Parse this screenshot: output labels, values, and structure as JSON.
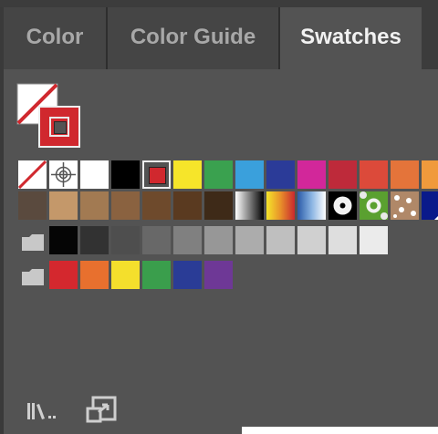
{
  "tabs": [
    {
      "label": "Color",
      "active": false
    },
    {
      "label": "Color Guide",
      "active": false
    },
    {
      "label": "Swatches",
      "active": true
    }
  ],
  "fill_stroke": {
    "fill": "none",
    "stroke": "#d0282e"
  },
  "swatch_rows": [
    {
      "group": false,
      "swatches": [
        {
          "kind": "none"
        },
        {
          "kind": "registration"
        },
        {
          "kind": "solid",
          "color": "#ffffff"
        },
        {
          "kind": "solid",
          "color": "#000000"
        },
        {
          "kind": "selected",
          "color": "#d0282e"
        },
        {
          "kind": "solid",
          "color": "#f6e52a"
        },
        {
          "kind": "solid",
          "color": "#3aa14f"
        },
        {
          "kind": "solid",
          "color": "#3aa0dc"
        },
        {
          "kind": "solid",
          "color": "#2b3b98"
        },
        {
          "kind": "solid",
          "color": "#d2279a"
        },
        {
          "kind": "solid",
          "color": "#be2a3a"
        },
        {
          "kind": "solid",
          "color": "#dc4a3a"
        },
        {
          "kind": "solid",
          "color": "#e4743a"
        },
        {
          "kind": "solid",
          "color": "#f09a3c"
        }
      ]
    },
    {
      "group": false,
      "swatches": [
        {
          "kind": "solid",
          "color": "#5a4a3e"
        },
        {
          "kind": "solid",
          "color": "#c4986a"
        },
        {
          "kind": "solid",
          "color": "#a27a52"
        },
        {
          "kind": "solid",
          "color": "#8a6240"
        },
        {
          "kind": "solid",
          "color": "#6e4a2c"
        },
        {
          "kind": "solid",
          "color": "#5a3a20"
        },
        {
          "kind": "solid",
          "color": "#3e2a18"
        },
        {
          "kind": "gradient-gray"
        },
        {
          "kind": "gradient-orange"
        },
        {
          "kind": "gradient-blue"
        },
        {
          "kind": "pattern-dots"
        },
        {
          "kind": "pattern-green"
        },
        {
          "kind": "pattern-leopard"
        },
        {
          "kind": "pattern-navy"
        }
      ]
    },
    {
      "group": true,
      "swatches": [
        {
          "kind": "solid",
          "color": "#050505"
        },
        {
          "kind": "solid",
          "color": "#323232"
        },
        {
          "kind": "solid",
          "color": "#4e4e4e"
        },
        {
          "kind": "solid",
          "color": "#686868"
        },
        {
          "kind": "solid",
          "color": "#808080"
        },
        {
          "kind": "solid",
          "color": "#979797"
        },
        {
          "kind": "solid",
          "color": "#acacac"
        },
        {
          "kind": "solid",
          "color": "#bfbfbf"
        },
        {
          "kind": "solid",
          "color": "#d0d0d0"
        },
        {
          "kind": "solid",
          "color": "#dedede"
        },
        {
          "kind": "solid",
          "color": "#ebebeb"
        }
      ]
    },
    {
      "group": true,
      "swatches": [
        {
          "kind": "solid",
          "color": "#d4282e"
        },
        {
          "kind": "solid",
          "color": "#e8702e"
        },
        {
          "kind": "solid",
          "color": "#f4df2c"
        },
        {
          "kind": "solid",
          "color": "#3a9e4c"
        },
        {
          "kind": "solid",
          "color": "#2a3c96"
        },
        {
          "kind": "solid",
          "color": "#6e3896"
        }
      ]
    }
  ],
  "bottom_icons": [
    "swatch-libraries-menu-icon",
    "place-swatches-icon"
  ]
}
